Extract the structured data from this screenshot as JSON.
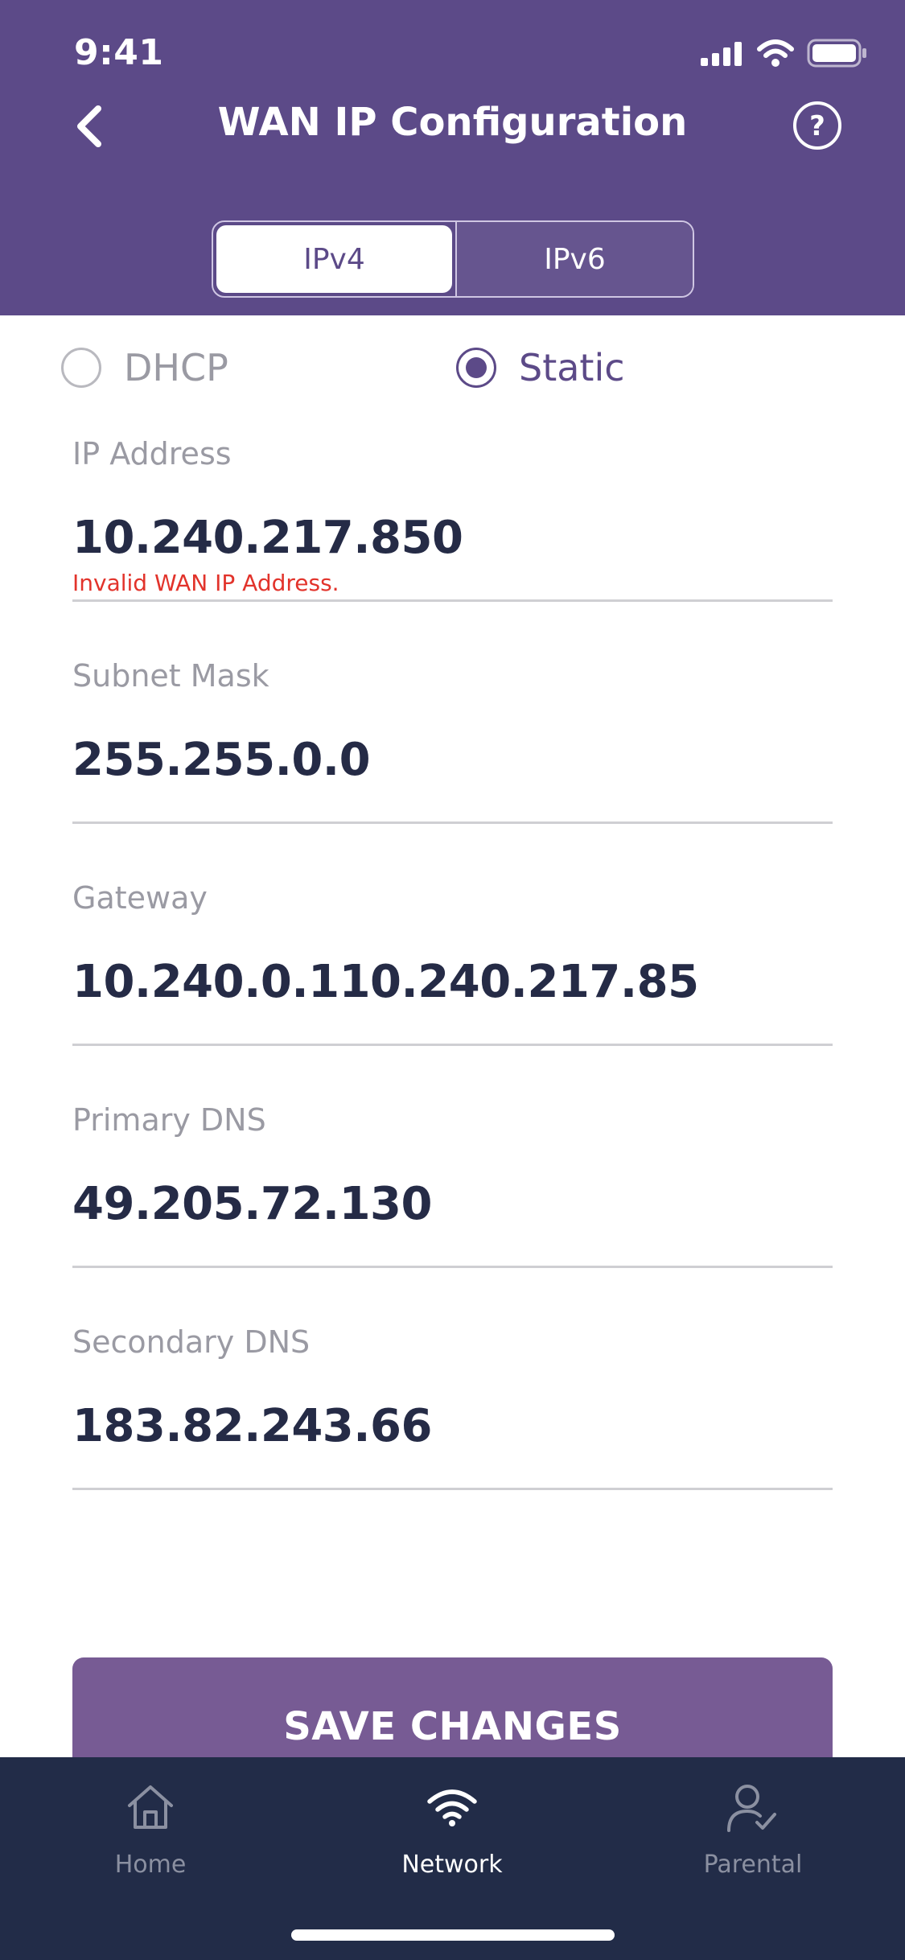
{
  "status_bar": {
    "time": "9:41"
  },
  "header": {
    "title": "WAN IP Configuration",
    "tabs": [
      {
        "label": "IPv4",
        "active": true
      },
      {
        "label": "IPv6",
        "active": false
      }
    ],
    "accent_color": "#5c4a88"
  },
  "mode": {
    "options": [
      {
        "label": "DHCP",
        "selected": false
      },
      {
        "label": "Static",
        "selected": true
      }
    ]
  },
  "fields": {
    "ip_address": {
      "label": "IP Address",
      "value": "10.240.217.850",
      "error": "Invalid WAN IP Address."
    },
    "subnet_mask": {
      "label": "Subnet Mask",
      "value": "255.255.0.0"
    },
    "gateway": {
      "label": "Gateway",
      "value": "10.240.0.110.240.217.85"
    },
    "primary_dns": {
      "label": "Primary DNS",
      "value": "49.205.72.130"
    },
    "secondary_dns": {
      "label": "Secondary DNS",
      "value": "183.82.243.66"
    }
  },
  "actions": {
    "save_label": "SAVE CHANGES"
  },
  "tabbar": {
    "items": [
      {
        "label": "Home",
        "icon": "home-icon",
        "active": false
      },
      {
        "label": "Network",
        "icon": "wifi-icon",
        "active": true
      },
      {
        "label": "Parental",
        "icon": "parental-icon",
        "active": false
      }
    ]
  }
}
